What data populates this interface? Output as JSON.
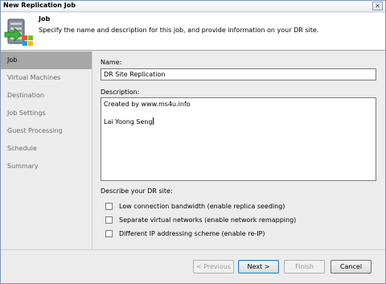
{
  "window": {
    "title": "New Replication Job",
    "close_glyph": "✕"
  },
  "header": {
    "title": "Job",
    "description": "Specify the name and description for this job, and provide information on your DR site.",
    "icon": "server-replication-icon"
  },
  "sidebar": {
    "items": [
      {
        "label": "Job",
        "active": true
      },
      {
        "label": "Virtual Machines",
        "active": false
      },
      {
        "label": "Destination",
        "active": false
      },
      {
        "label": "Job Settings",
        "active": false
      },
      {
        "label": "Guest Processing",
        "active": false
      },
      {
        "label": "Schedule",
        "active": false
      },
      {
        "label": "Summary",
        "active": false
      }
    ]
  },
  "form": {
    "name_label": "Name:",
    "name_value": "DR Site Replication",
    "description_label": "Description:",
    "description_lines": [
      "Created by www.ms4u.info",
      "",
      "Lai Yoong Seng"
    ],
    "dr_site_label": "Describe your DR site:",
    "options": [
      {
        "label": "Low connection bandwidth (enable replica seeding)",
        "checked": false
      },
      {
        "label": "Separate virtual networks (enable network remapping)",
        "checked": false
      },
      {
        "label": "Different IP addressing scheme (enable re-IP)",
        "checked": false
      }
    ]
  },
  "footer": {
    "previous_label": "< Previous",
    "next_label": "Next >",
    "finish_label": "Finish",
    "cancel_label": "Cancel"
  },
  "colors": {
    "active_nav_bg": "#a7a7a7",
    "inactive_nav_text": "#6b6b6b",
    "window_border": "#7a96b8"
  }
}
